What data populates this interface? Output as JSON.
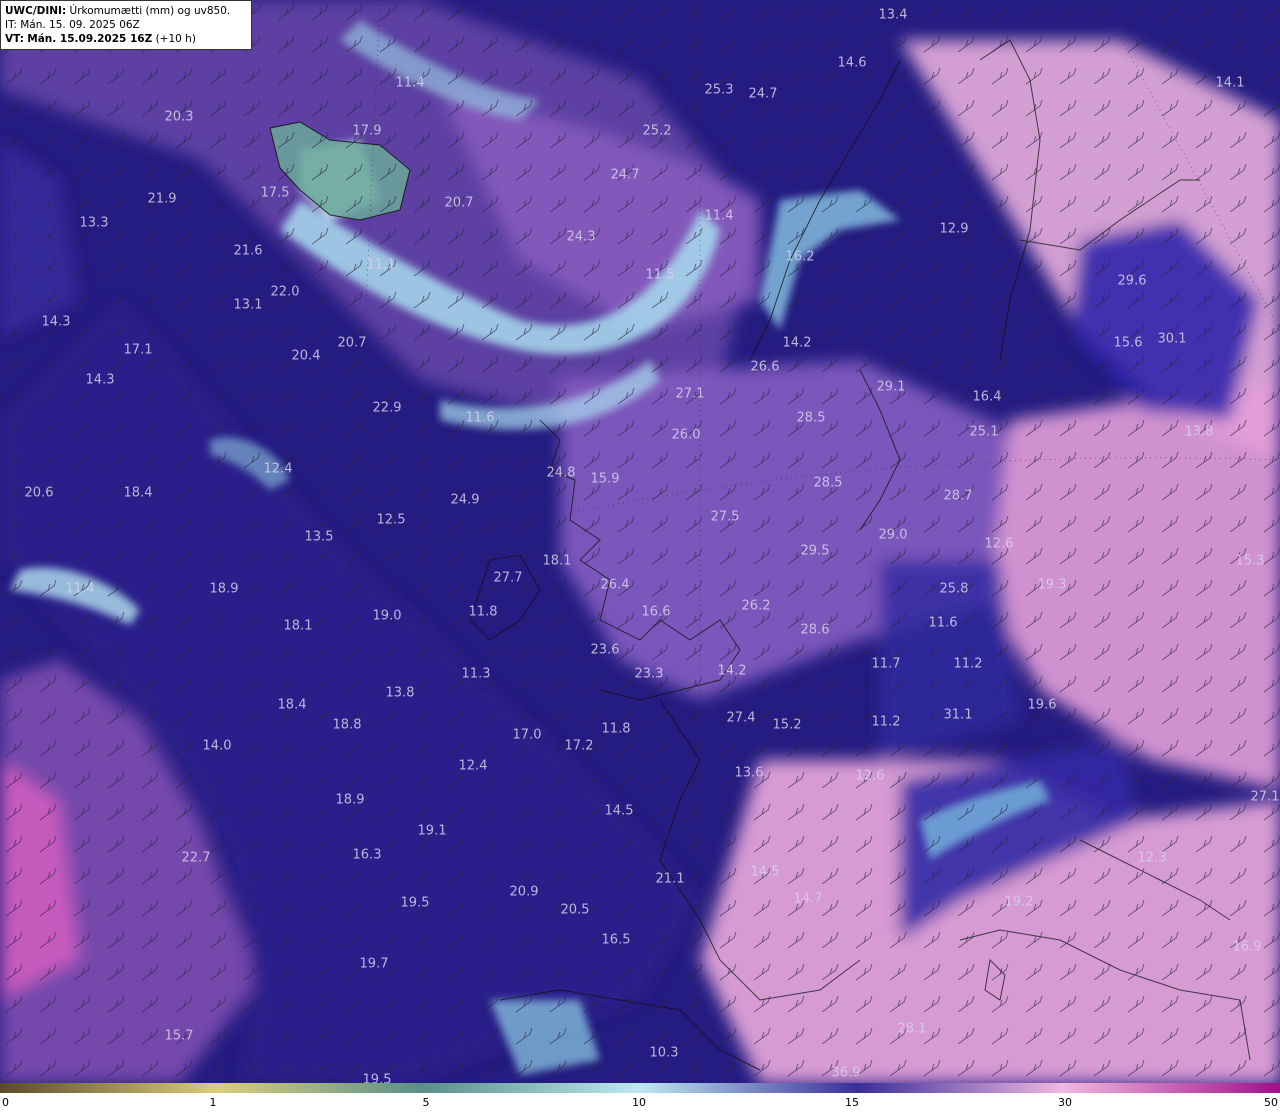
{
  "header": {
    "model": "UWC/DINI:",
    "parameter": "Úrkomumætti (mm) og uv850.",
    "init_time": "IT: Mán. 15. 09. 2025 06Z",
    "valid_prefix": "VT:",
    "valid_time": "Mán. 15.09.2025 16Z",
    "lead": "(+10 h)"
  },
  "colorbar": {
    "ticks": [
      "0",
      "1",
      "5",
      "10",
      "15",
      "30",
      "50"
    ],
    "colors": [
      "#5a4a2a",
      "#d9cf7a",
      "#5a8f8a",
      "#bfe8f0",
      "#3a2e9a",
      "#f0b8e0",
      "#a0108a"
    ]
  },
  "values": [
    "13.4",
    "14.6",
    "25.3",
    "24.7",
    "14.1",
    "11.4",
    "20.3",
    "17.9",
    "25.2",
    "24.7",
    "17.5",
    "21.9",
    "20.7",
    "11.4",
    "12.9",
    "13.3",
    "24.3",
    "21.6",
    "11.1",
    "11.5",
    "16.2",
    "29.6",
    "22.0",
    "13.1",
    "14.3",
    "17.1",
    "20.7",
    "20.4",
    "14.2",
    "15.6",
    "30.1",
    "14.3",
    "26.6",
    "27.1",
    "29.1",
    "22.9",
    "11.6",
    "28.5",
    "16.4",
    "26.0",
    "25.1",
    "13.8",
    "12.4",
    "24.8",
    "15.9",
    "20.6",
    "18.4",
    "24.9",
    "28.5",
    "28.7",
    "12.5",
    "27.5",
    "13.5",
    "29.0",
    "12.6",
    "29.5",
    "18.1",
    "27.7",
    "15.3",
    "18.9",
    "11.4",
    "26.4",
    "19.3",
    "25.8",
    "11.8",
    "19.0",
    "18.1",
    "16.6",
    "26.2",
    "28.6",
    "11.6",
    "23.6",
    "11.7",
    "11.2",
    "11.3",
    "23.3",
    "14.2",
    "13.8",
    "18.4",
    "19.6",
    "18.8",
    "27.4",
    "15.2",
    "11.8",
    "11.2",
    "31.1",
    "17.0",
    "17.2",
    "14.0",
    "12.4",
    "13.6",
    "12.6",
    "18.9",
    "14.5",
    "19.1",
    "16.3",
    "22.7",
    "21.1",
    "14.5",
    "12.3",
    "20.9",
    "14.7",
    "19.2",
    "27.1",
    "19.5",
    "20.5",
    "16.5",
    "19.7",
    "16.9",
    "15.7",
    "10.3",
    "28.1",
    "19.5",
    "36.9"
  ]
}
